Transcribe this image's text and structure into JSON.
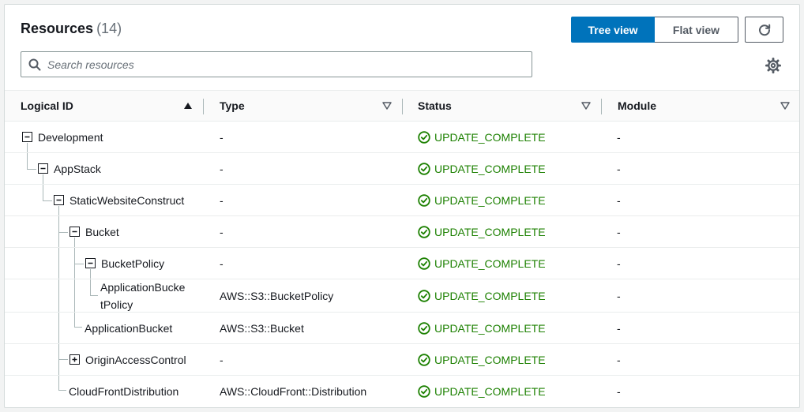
{
  "header": {
    "title": "Resources",
    "count": "(14)",
    "tree_view_label": "Tree view",
    "flat_view_label": "Flat view"
  },
  "search": {
    "placeholder": "Search resources"
  },
  "columns": {
    "logical_id": "Logical ID",
    "type": "Type",
    "status": "Status",
    "module": "Module"
  },
  "rows": [
    {
      "id": "Development",
      "type": "-",
      "status": "UPDATE_COMPLETE",
      "module": "-"
    },
    {
      "id": "AppStack",
      "type": "-",
      "status": "UPDATE_COMPLETE",
      "module": "-"
    },
    {
      "id": "StaticWebsiteConstruct",
      "type": "-",
      "status": "UPDATE_COMPLETE",
      "module": "-"
    },
    {
      "id": "Bucket",
      "type": "-",
      "status": "UPDATE_COMPLETE",
      "module": "-"
    },
    {
      "id": "BucketPolicy",
      "type": "-",
      "status": "UPDATE_COMPLETE",
      "module": "-"
    },
    {
      "id_line1": "ApplicationBucke",
      "id_line2": "tPolicy",
      "type": "AWS::S3::BucketPolicy",
      "status": "UPDATE_COMPLETE",
      "module": "-"
    },
    {
      "id": "ApplicationBucket",
      "type": "AWS::S3::Bucket",
      "status": "UPDATE_COMPLETE",
      "module": "-"
    },
    {
      "id": "OriginAccessControl",
      "type": "-",
      "status": "UPDATE_COMPLETE",
      "module": "-"
    },
    {
      "id": "CloudFrontDistribution",
      "type": "AWS::CloudFront::Distribution",
      "status": "UPDATE_COMPLETE",
      "module": "-"
    }
  ],
  "colors": {
    "accent": "#0073bb",
    "success": "#1d8102",
    "border": "#eaeded"
  },
  "icons": [
    "search-icon",
    "refresh-icon",
    "settings-gear-icon",
    "sort-ascending-icon",
    "sort-descending-icon",
    "collapse-icon",
    "expand-icon",
    "success-status-icon"
  ]
}
